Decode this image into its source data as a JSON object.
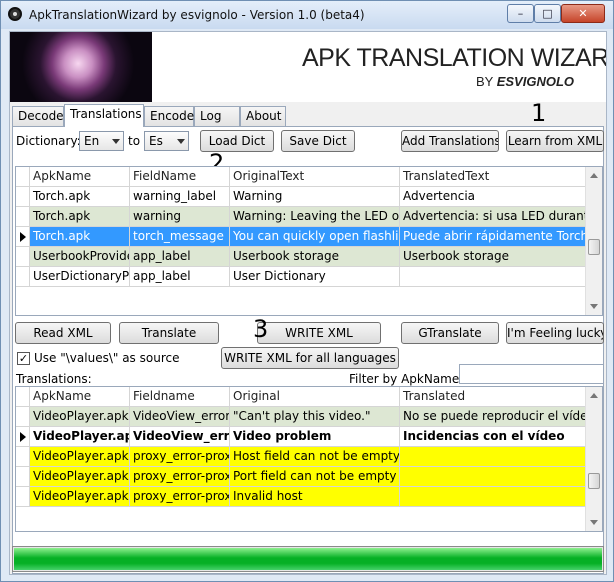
{
  "window": {
    "title": "ApkTranslationWizard by esvignolo - Version 1.0 (beta4)",
    "controls": {
      "min": "–",
      "max": "□",
      "close": "✕"
    }
  },
  "banner": {
    "title": "APK TRANSLATION WIZARD",
    "by": "BY ",
    "author": "ESVIGNOLO"
  },
  "tabs": [
    "Decode",
    "Translations",
    "Encode",
    "Log",
    "About"
  ],
  "active_tab": "Translations",
  "toolbar": {
    "dictionary_label": "Dictionary:",
    "from_lang": "En",
    "to_label": "to",
    "to_lang": "Es",
    "load_dict": "Load Dict",
    "save_dict": "Save Dict",
    "add_translations": "Add Translations",
    "learn_from_xml": "Learn from XML"
  },
  "markers": {
    "one": "1",
    "two": "2",
    "three": "3"
  },
  "dict_grid": {
    "columns": [
      "ApkName",
      "FieldName",
      "OriginalText",
      "TranslatedText"
    ],
    "rows": [
      {
        "cells": [
          "Torch.apk",
          "warning_label",
          "Warning",
          "Advertencia"
        ],
        "style": "white"
      },
      {
        "cells": [
          "Torch.apk",
          "warning",
          "Warning: Leaving the LED on for long periods",
          "Advertencia: si usa LED durante mucho tiempo"
        ],
        "style": "gray"
      },
      {
        "cells": [
          "Torch.apk",
          "torch_message",
          "You can quickly open flashlight",
          "Puede abrir rápidamente Torch"
        ],
        "style": "sel",
        "current": true
      },
      {
        "cells": [
          "UserbookProvider",
          "app_label",
          "Userbook storage",
          "Userbook storage"
        ],
        "style": "gray"
      },
      {
        "cells": [
          "UserDictionaryProvider",
          "app_label",
          "User Dictionary",
          ""
        ],
        "style": "white"
      }
    ]
  },
  "actions": {
    "read_xml": "Read XML",
    "translate": "Translate",
    "write_xml": "WRITE XML",
    "gtranslate": "GTranslate",
    "feeling_lucky": "I'm Feeling lucky",
    "use_values_source": "Use \"\\values\\\" as source",
    "use_values_checked": true,
    "write_xml_all": "WRITE XML for all languages"
  },
  "translations_section": {
    "label": "Translations:",
    "filter_label": "Filter by ApkName:",
    "filter_value": ""
  },
  "trans_grid": {
    "columns": [
      "ApkName",
      "Fieldname",
      "Original",
      "Translated"
    ],
    "rows": [
      {
        "cells": [
          "VideoPlayer.apk",
          "VideoView_error_text",
          "\"Can't play this video.\"",
          "No se puede reproducir el vídeo"
        ],
        "style": "gray"
      },
      {
        "cells": [
          "VideoPlayer.apk",
          "VideoView_error_title",
          "Video problem",
          "Incidencias con el vídeo"
        ],
        "style": "white",
        "bold": true,
        "current": true
      },
      {
        "cells": [
          "VideoPlayer.apk",
          "proxy_error-proxy_host",
          "Host field can not be empty",
          ""
        ],
        "style": "yellow"
      },
      {
        "cells": [
          "VideoPlayer.apk",
          "proxy_error-proxy_port",
          "Port field can not be empty",
          ""
        ],
        "style": "yellow"
      },
      {
        "cells": [
          "VideoPlayer.apk",
          "proxy_error-proxy_invalid",
          "Invalid host",
          ""
        ],
        "style": "yellow"
      }
    ]
  },
  "progress": {
    "fraction": 1.0
  },
  "colors": {
    "selected_row": "#3399ff",
    "alt_row": "#dde7d3",
    "missing_translation": "#ffff00",
    "progress_fill": "#06b025"
  }
}
